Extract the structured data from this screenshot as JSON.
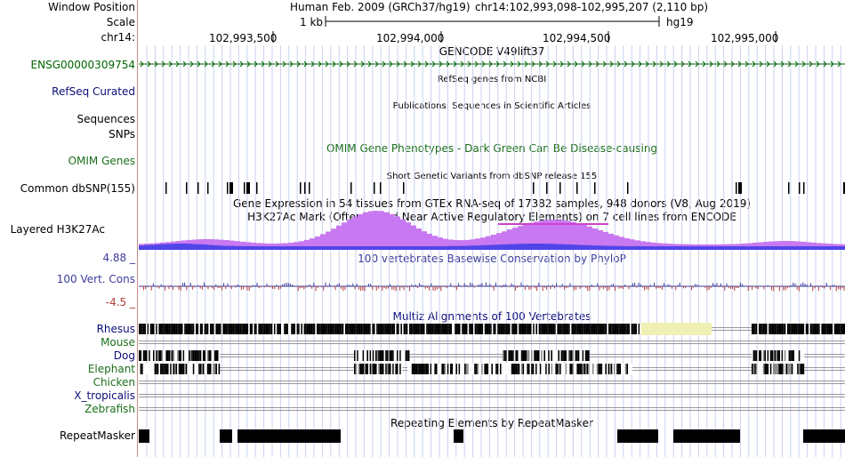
{
  "header": {
    "window_position_label": "Window Position",
    "scale_label": "Scale",
    "chrom_label": "chr14:",
    "assembly": "Human Feb. 2009 (GRCh37/hg19)",
    "position": "chr14:102,993,098-102,995,207 (2,110 bp)",
    "scale_text": "1 kb",
    "scale_db": "hg19",
    "ruler_ticks": [
      "102,993,500",
      "102,994,000",
      "102,994,500",
      "102,995,000"
    ]
  },
  "tracks": {
    "gencode": {
      "title": "GENCODE V49lift37",
      "item": "ENSG00000309754"
    },
    "refseq": {
      "title": "RefSeq genes from NCBI",
      "label": "RefSeq Curated"
    },
    "publications": {
      "title": "Publications: Sequences in Scientific Articles",
      "label": "Sequences"
    },
    "snps": {
      "label": "SNPs"
    },
    "omim": {
      "title": "OMIM Gene Phenotypes - Dark Green Can Be Disease-causing",
      "label": "OMIM Genes"
    },
    "dbsnp": {
      "title": "Short Genetic Variants from dbSNP release 155",
      "label": "Common dbSNP(155)"
    },
    "gtex": {
      "title": "Gene Expression in 54 tissues from GTEx RNA-seq of 17382 samples, 948 donors (V8, Aug 2019)"
    },
    "h3k27ac": {
      "title": "H3K27Ac Mark (Often Found Near Active Regulatory Elements) on 7 cell lines from ENCODE",
      "label": "Layered H3K27Ac"
    },
    "conservation": {
      "title": "100 vertebrates Basewise Conservation by PhyloP",
      "label": "100 Vert. Cons",
      "max": "4.88 _",
      "min": "-4.5 _"
    },
    "multiz": {
      "title": "Multiz Alignments of 100 Vertebrates",
      "species": [
        "Rhesus",
        "Mouse",
        "Dog",
        "Elephant",
        "Chicken",
        "X_tropicalis",
        "Zebrafish"
      ]
    },
    "repeatmasker": {
      "title": "Repeating Elements by RepeatMasker",
      "label": "RepeatMasker"
    }
  },
  "colors": {
    "gencode_green": "#006400",
    "refseq_navy": "#0c0c78",
    "omim_green": "#1a6e1a",
    "phylop_blue": "#3c3c9c",
    "h3k27ac_purple": "#c878f0",
    "h3k27ac_blue": "#3c3ce6",
    "gtex_magenta": "#d040d0",
    "multiz_gap_yellow": "#f0f0b4",
    "divider_red": "#cf8a8a"
  }
}
